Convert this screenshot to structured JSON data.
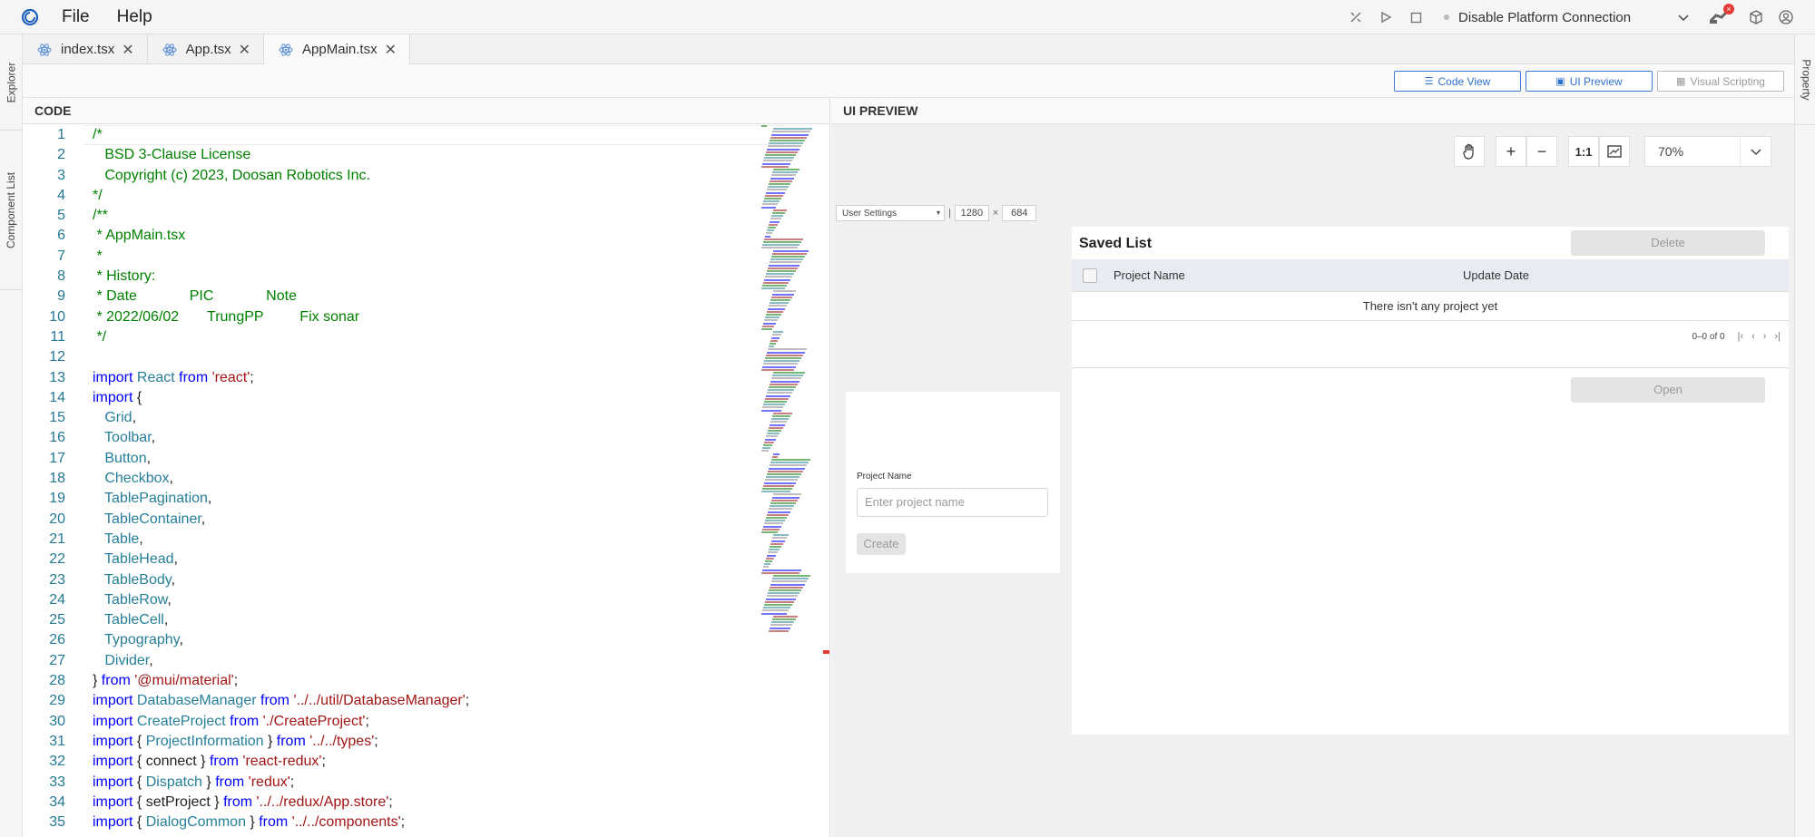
{
  "menubar": {
    "menus": [
      "File",
      "Help"
    ],
    "platform_connection": "Disable Platform Connection",
    "robot_badge": "×"
  },
  "sidebar_left": {
    "explorer": "Explorer",
    "component_list": "Component List"
  },
  "sidebar_right": {
    "property": "Property"
  },
  "tabs": [
    {
      "label": "index.tsx"
    },
    {
      "label": "App.tsx"
    },
    {
      "label": "AppMain.tsx"
    }
  ],
  "view_buttons": {
    "code_view": "Code View",
    "ui_preview": "UI Preview",
    "visual_scripting": "Visual Scripting"
  },
  "code_panel": {
    "title": "CODE",
    "lines": [
      [
        [
          "c-com",
          "/*"
        ]
      ],
      [
        [
          "c-com",
          "   BSD 3-Clause License"
        ]
      ],
      [
        [
          "c-com",
          "   Copyright (c) 2023, Doosan Robotics Inc."
        ]
      ],
      [
        [
          "c-com",
          "*/"
        ]
      ],
      [
        [
          "c-com",
          "/**"
        ]
      ],
      [
        [
          "c-com",
          " * AppMain.tsx"
        ]
      ],
      [
        [
          "c-com",
          " *"
        ]
      ],
      [
        [
          "c-com",
          " * History:"
        ]
      ],
      [
        [
          "c-com",
          " * Date             PIC             Note"
        ]
      ],
      [
        [
          "c-com",
          " * 2022/06/02       TrungPP         Fix sonar"
        ]
      ],
      [
        [
          "c-com",
          " */"
        ]
      ],
      [
        [
          "c-txt",
          ""
        ]
      ],
      [
        [
          "c-kw",
          "import "
        ],
        [
          "c-id",
          "React "
        ],
        [
          "c-kw",
          "from "
        ],
        [
          "c-str",
          "'react'"
        ],
        [
          "c-txt",
          ";"
        ]
      ],
      [
        [
          "c-kw",
          "import "
        ],
        [
          "c-txt",
          "{"
        ]
      ],
      [
        [
          "c-id",
          "   Grid"
        ],
        [
          "c-txt",
          ","
        ]
      ],
      [
        [
          "c-id",
          "   Toolbar"
        ],
        [
          "c-txt",
          ","
        ]
      ],
      [
        [
          "c-id",
          "   Button"
        ],
        [
          "c-txt",
          ","
        ]
      ],
      [
        [
          "c-id",
          "   Checkbox"
        ],
        [
          "c-txt",
          ","
        ]
      ],
      [
        [
          "c-id",
          "   TablePagination"
        ],
        [
          "c-txt",
          ","
        ]
      ],
      [
        [
          "c-id",
          "   TableContainer"
        ],
        [
          "c-txt",
          ","
        ]
      ],
      [
        [
          "c-id",
          "   Table"
        ],
        [
          "c-txt",
          ","
        ]
      ],
      [
        [
          "c-id",
          "   TableHead"
        ],
        [
          "c-txt",
          ","
        ]
      ],
      [
        [
          "c-id",
          "   TableBody"
        ],
        [
          "c-txt",
          ","
        ]
      ],
      [
        [
          "c-id",
          "   TableRow"
        ],
        [
          "c-txt",
          ","
        ]
      ],
      [
        [
          "c-id",
          "   TableCell"
        ],
        [
          "c-txt",
          ","
        ]
      ],
      [
        [
          "c-id",
          "   Typography"
        ],
        [
          "c-txt",
          ","
        ]
      ],
      [
        [
          "c-id",
          "   Divider"
        ],
        [
          "c-txt",
          ","
        ]
      ],
      [
        [
          "c-txt",
          "} "
        ],
        [
          "c-kw",
          "from "
        ],
        [
          "c-str",
          "'@mui/material'"
        ],
        [
          "c-txt",
          ";"
        ]
      ],
      [
        [
          "c-kw",
          "import "
        ],
        [
          "c-id",
          "DatabaseManager "
        ],
        [
          "c-kw",
          "from "
        ],
        [
          "c-str",
          "'../../util/DatabaseManager'"
        ],
        [
          "c-txt",
          ";"
        ]
      ],
      [
        [
          "c-kw",
          "import "
        ],
        [
          "c-id",
          "CreateProject "
        ],
        [
          "c-kw",
          "from "
        ],
        [
          "c-str",
          "'./CreateProject'"
        ],
        [
          "c-txt",
          ";"
        ]
      ],
      [
        [
          "c-kw",
          "import "
        ],
        [
          "c-txt",
          "{ "
        ],
        [
          "c-id",
          "ProjectInformation "
        ],
        [
          "c-txt",
          "} "
        ],
        [
          "c-kw",
          "from "
        ],
        [
          "c-str",
          "'../../types'"
        ],
        [
          "c-txt",
          ";"
        ]
      ],
      [
        [
          "c-kw",
          "import "
        ],
        [
          "c-txt",
          "{ connect } "
        ],
        [
          "c-kw",
          "from "
        ],
        [
          "c-str",
          "'react-redux'"
        ],
        [
          "c-txt",
          ";"
        ]
      ],
      [
        [
          "c-kw",
          "import "
        ],
        [
          "c-txt",
          "{ "
        ],
        [
          "c-id",
          "Dispatch "
        ],
        [
          "c-txt",
          "} "
        ],
        [
          "c-kw",
          "from "
        ],
        [
          "c-str",
          "'redux'"
        ],
        [
          "c-txt",
          ";"
        ]
      ],
      [
        [
          "c-kw",
          "import "
        ],
        [
          "c-txt",
          "{ setProject } "
        ],
        [
          "c-kw",
          "from "
        ],
        [
          "c-str",
          "'../../redux/App.store'"
        ],
        [
          "c-txt",
          ";"
        ]
      ],
      [
        [
          "c-kw",
          "import "
        ],
        [
          "c-txt",
          "{ "
        ],
        [
          "c-id",
          "DialogCommon "
        ],
        [
          "c-txt",
          "} "
        ],
        [
          "c-kw",
          "from "
        ],
        [
          "c-str",
          "'../../components'"
        ],
        [
          "c-txt",
          ";"
        ]
      ]
    ]
  },
  "preview_panel": {
    "title": "UI PREVIEW",
    "zoom_ratio_label": "1:1",
    "zoom_value": "70%",
    "device": {
      "name": "User Settings",
      "width": "1280",
      "height": "684",
      "x": "×"
    },
    "create_form": {
      "label": "Project Name",
      "placeholder": "Enter project name",
      "create": "Create"
    },
    "saved_list": {
      "title": "Saved List",
      "delete": "Delete",
      "col_name": "Project Name",
      "col_date": "Update Date",
      "empty": "There isn't any project yet",
      "range": "0–0 of 0",
      "open": "Open"
    }
  },
  "colors": {
    "accent": "#2f6fcf",
    "comment": "#008000",
    "keyword": "#0000ff",
    "string": "#a31515",
    "identifier": "#267f99"
  }
}
